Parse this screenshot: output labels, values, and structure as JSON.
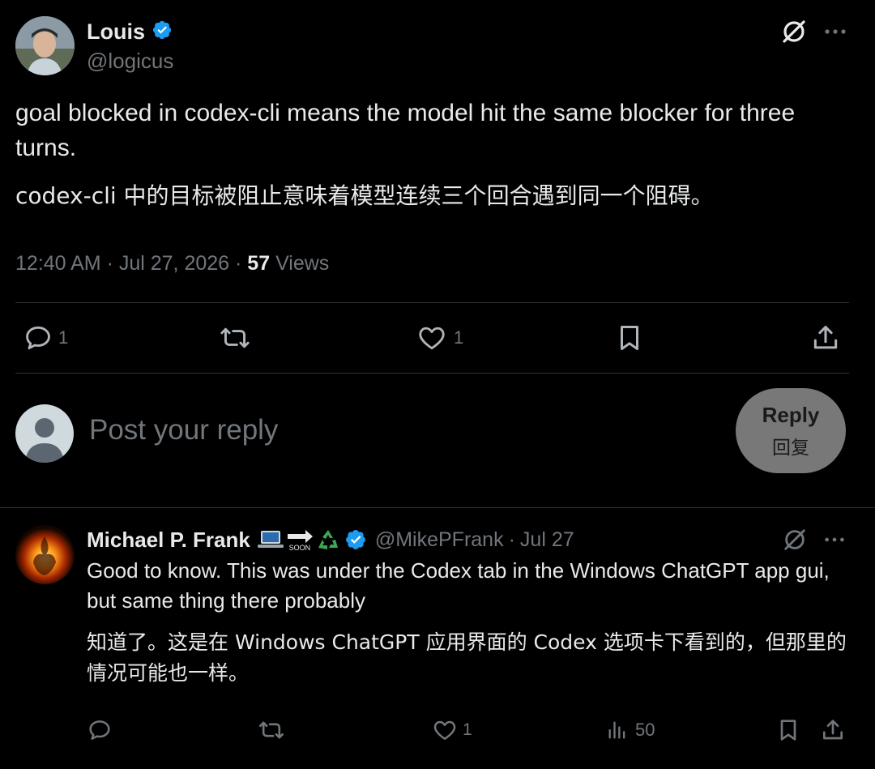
{
  "tweet": {
    "author": {
      "name": "Louis",
      "handle": "@logicus",
      "verified": true
    },
    "text_en": "goal blocked in codex-cli means the model hit the same blocker for three turns.",
    "text_zh": "codex-cli 中的目标被阻止意味着模型连续三个回合遇到同一个阻碍。",
    "timestamp": "12:40 AM · Jul 27, 2026 ·",
    "views_count": "57",
    "views_label": "Views",
    "actions": {
      "reply_count": "1",
      "like_count": "1"
    },
    "icons": {
      "grok": "grok-icon",
      "more": "more-icon",
      "reply": "reply-icon",
      "retweet": "retweet-icon",
      "like": "heart-icon",
      "bookmark": "bookmark-icon",
      "share": "share-icon"
    }
  },
  "composer": {
    "placeholder": "Post your reply",
    "button_label": "Reply",
    "button_label_zh": "回复"
  },
  "reply_tweet": {
    "author": {
      "name": "Michael P. Frank",
      "handle": "@MikePFrank",
      "date": "Jul 27",
      "verified": true,
      "name_emoji_badge": "SOON"
    },
    "text_en": "Good to know. This was under the Codex tab in the Windows ChatGPT app gui, but same thing there probably",
    "text_zh": "知道了。这是在 Windows ChatGPT 应用界面的 Codex 选项卡下看到的，但那里的情况可能也一样。",
    "actions": {
      "like_count": "1",
      "views_count": "50"
    }
  },
  "colors": {
    "background": "#000000",
    "text_primary": "#e7e9ea",
    "text_secondary": "#71767b",
    "divider": "#2f3336",
    "verified_blue": "#1d9bf0",
    "reply_button_bg": "#787878"
  }
}
